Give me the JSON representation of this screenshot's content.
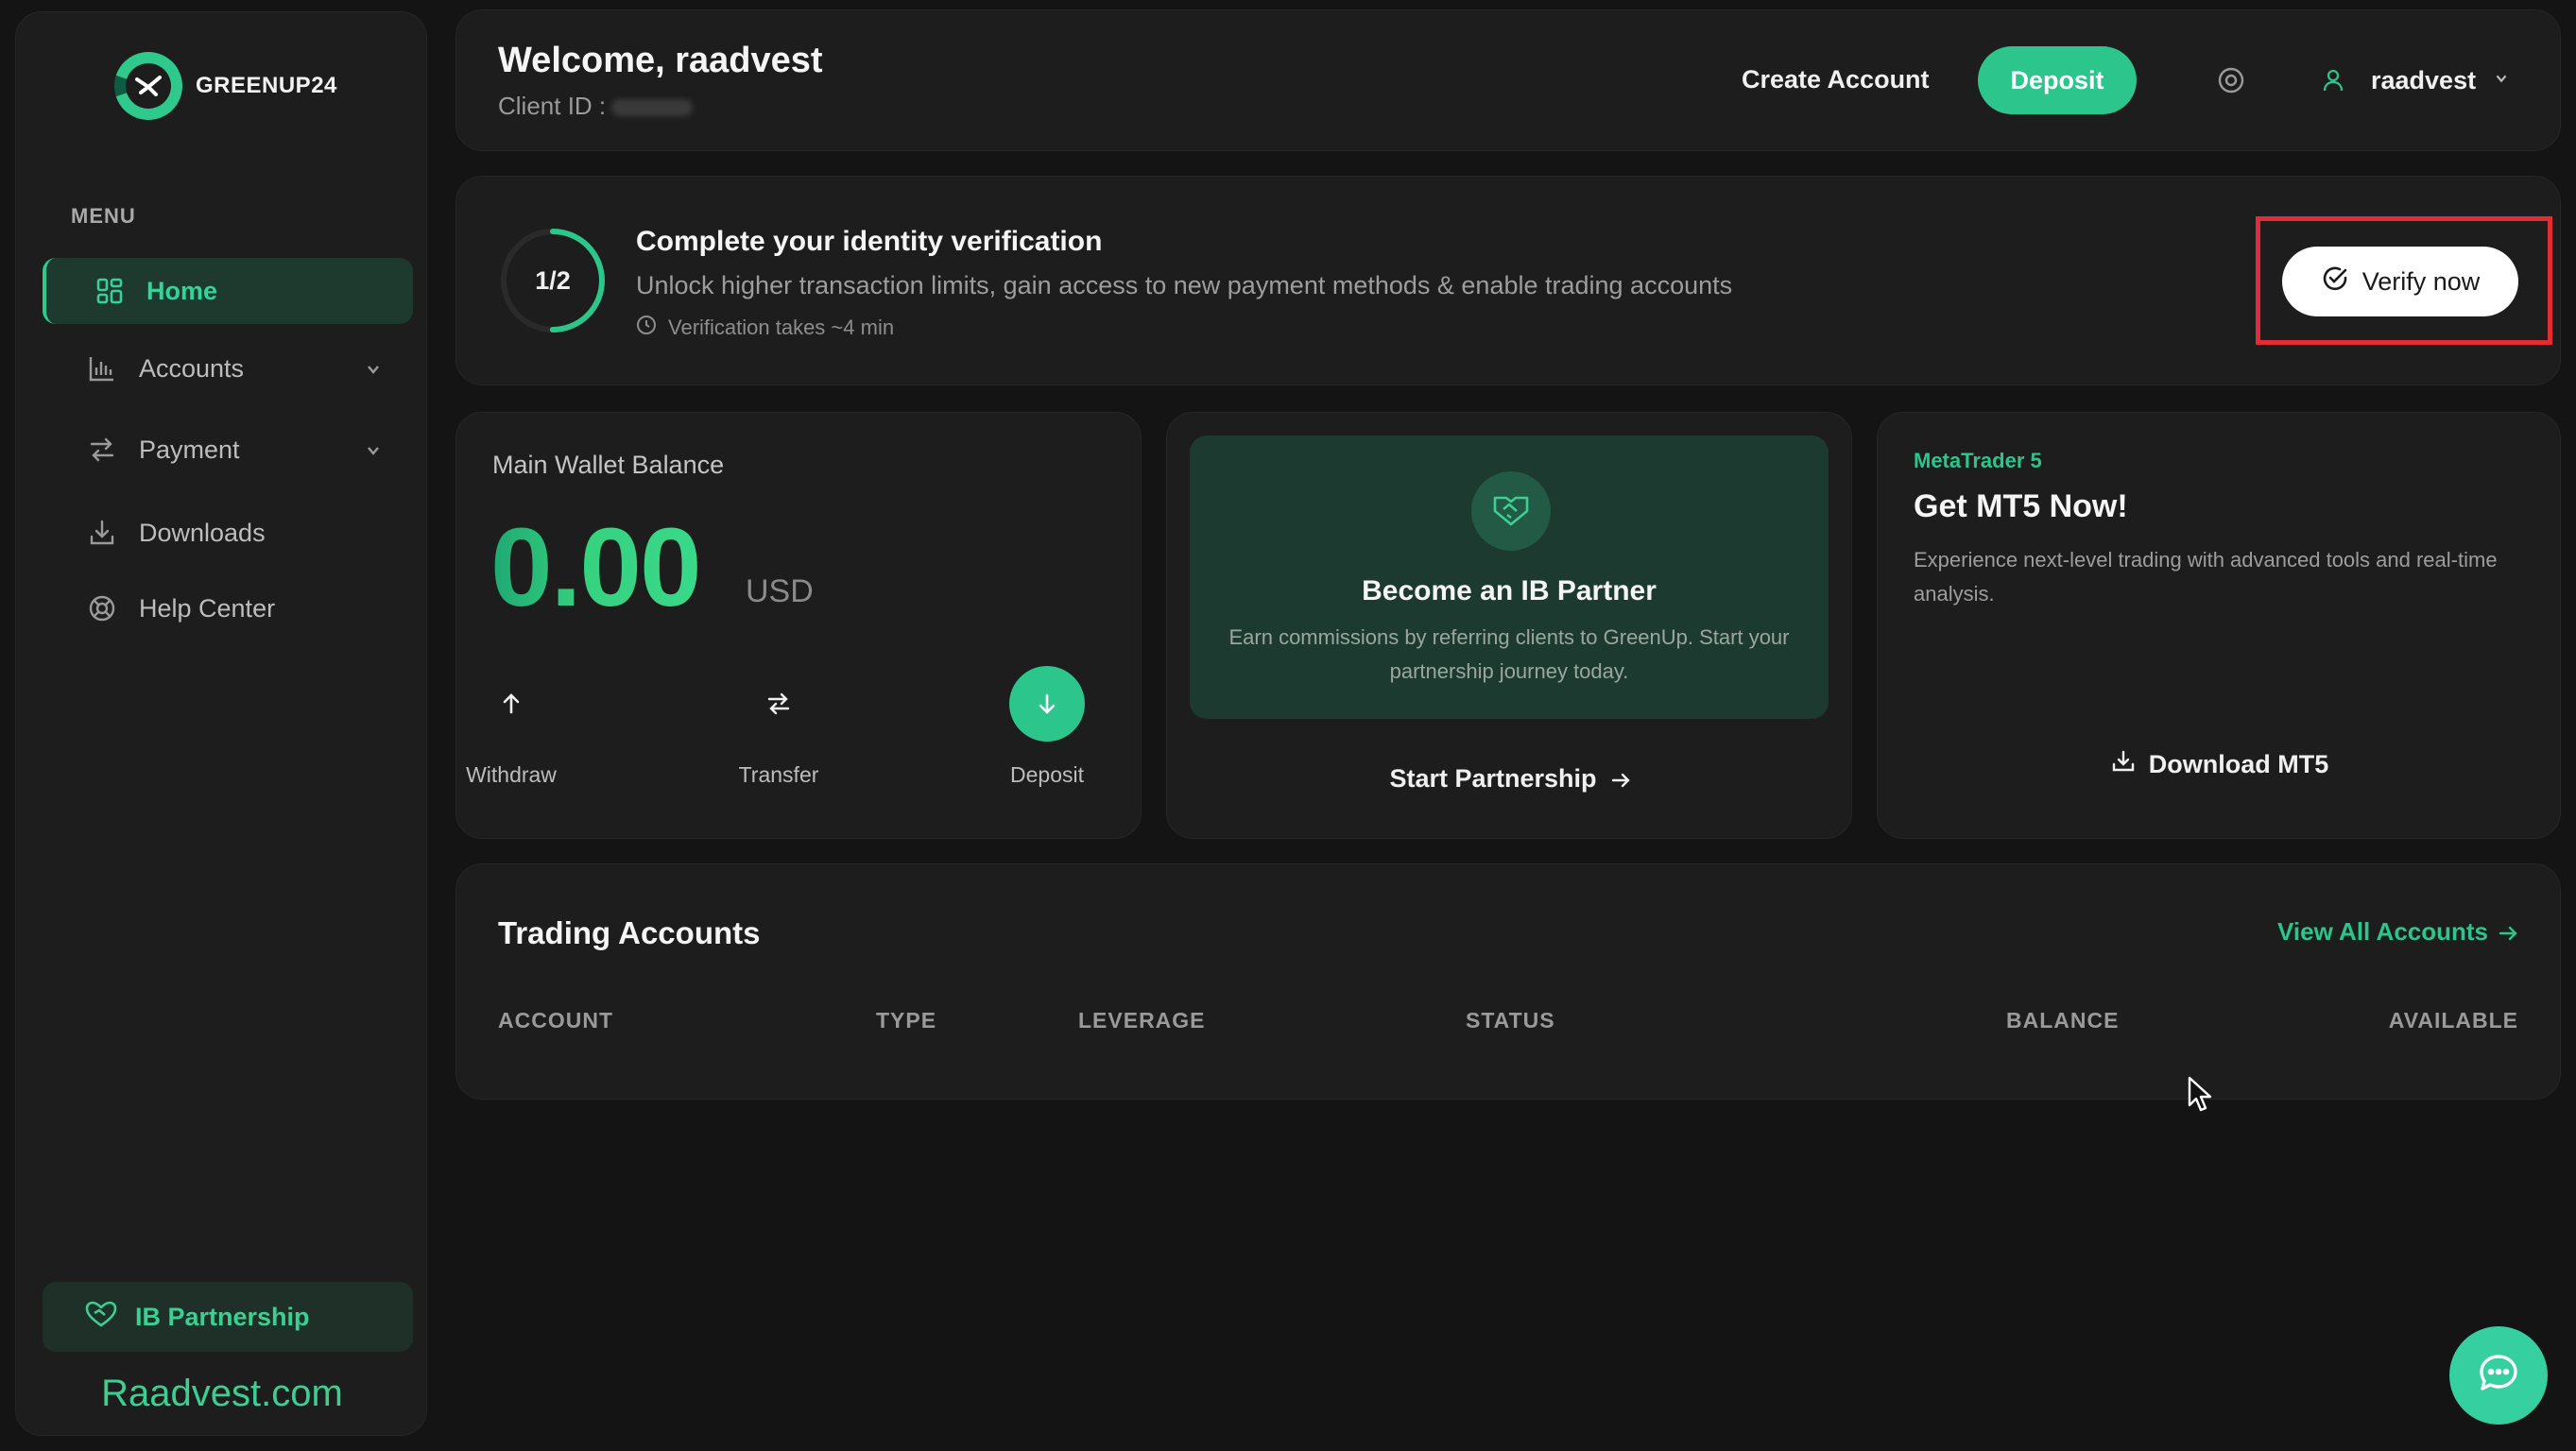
{
  "brand": {
    "name": "GREENUP24",
    "website": "Raadvest.com"
  },
  "sidebar": {
    "menu_label": "MENU",
    "items": [
      {
        "label": "Home",
        "icon": "grid-icon",
        "active": true
      },
      {
        "label": "Accounts",
        "icon": "bar-chart-icon",
        "expandable": true
      },
      {
        "label": "Payment",
        "icon": "swap-icon",
        "expandable": true
      },
      {
        "label": "Downloads",
        "icon": "download-icon"
      },
      {
        "label": "Help Center",
        "icon": "lifebuoy-icon"
      }
    ],
    "ib_partnership": "IB Partnership"
  },
  "header": {
    "welcome": "Welcome, raadvest",
    "client_id_label": "Client ID :",
    "create_account": "Create Account",
    "deposit": "Deposit",
    "username": "raadvest"
  },
  "verification": {
    "progress": "1/2",
    "progress_fraction": 0.5,
    "title": "Complete your identity verification",
    "description": "Unlock higher transaction limits, gain access to new payment methods & enable trading accounts",
    "time_note": "Verification takes ~4 min",
    "button": "Verify now"
  },
  "wallet": {
    "label": "Main Wallet Balance",
    "amount": "0.00",
    "currency": "USD",
    "actions": {
      "withdraw": "Withdraw",
      "transfer": "Transfer",
      "deposit": "Deposit"
    }
  },
  "ib_card": {
    "title": "Become an IB Partner",
    "description": "Earn commissions by referring clients to GreenUp. Start your partnership journey today.",
    "link": "Start Partnership"
  },
  "mt5": {
    "tag": "MetaTrader 5",
    "title": "Get MT5 Now!",
    "description": "Experience next-level trading with advanced tools and real-time analysis.",
    "download": "Download MT5"
  },
  "trading_accounts": {
    "title": "Trading Accounts",
    "view_all": "View All Accounts",
    "columns": [
      "ACCOUNT",
      "TYPE",
      "LEVERAGE",
      "STATUS",
      "BALANCE",
      "AVAILABLE"
    ]
  },
  "colors": {
    "accent": "#2cc58c",
    "highlight": "#e12c37",
    "background": "#141414",
    "card": "#1d1d1d"
  }
}
